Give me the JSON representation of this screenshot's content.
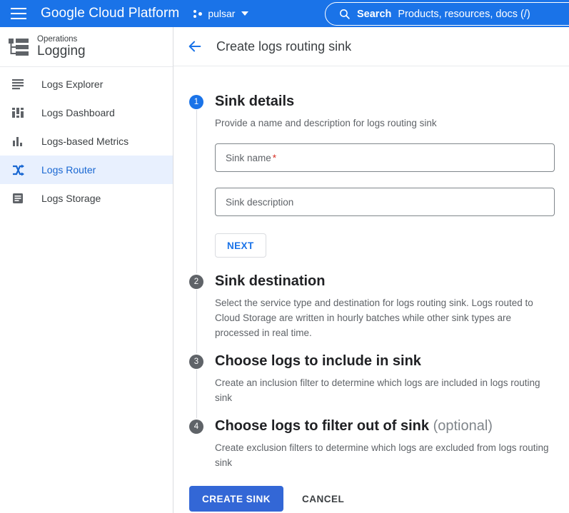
{
  "topbar": {
    "menu_icon": "hamburger-menu-icon",
    "brand": "Google Cloud Platform",
    "project_icon": "project-dots-icon",
    "project_name": "pulsar",
    "project_caret_icon": "chevron-down-icon",
    "search": {
      "icon": "search-icon",
      "label": "Search",
      "placeholder": "Products, resources, docs (/)"
    },
    "colors": {
      "background": "#1a73e8",
      "foreground": "#ffffff"
    }
  },
  "sidebar": {
    "product_icon": "logging-hierarchy-icon",
    "product_sub": "Operations",
    "product_title": "Logging",
    "items": [
      {
        "label": "Logs Explorer",
        "icon": "list-lines-icon",
        "active": false
      },
      {
        "label": "Logs Dashboard",
        "icon": "dashboard-icon",
        "active": false
      },
      {
        "label": "Logs-based Metrics",
        "icon": "bar-chart-icon",
        "active": false
      },
      {
        "label": "Logs Router",
        "icon": "shuffle-route-icon",
        "active": true
      },
      {
        "label": "Logs Storage",
        "icon": "storage-doc-icon",
        "active": false
      }
    ],
    "active_colors": {
      "background": "#e8f0fe",
      "text": "#1967d2"
    }
  },
  "page": {
    "back_icon": "back-arrow-icon",
    "title": "Create logs routing sink"
  },
  "steps": [
    {
      "number": "1",
      "title": "Sink details",
      "optional": "",
      "state": "active",
      "description": "Provide a name and description for logs routing sink",
      "fields": [
        {
          "placeholder": "Sink name",
          "required": true,
          "value": ""
        },
        {
          "placeholder": "Sink description",
          "required": false,
          "value": ""
        }
      ],
      "next_label": "NEXT"
    },
    {
      "number": "2",
      "title": "Sink destination",
      "optional": "",
      "state": "inactive",
      "description": "Select the service type and destination for logs routing sink. Logs routed to Cloud Storage are written in hourly batches while other sink types are processed in real time."
    },
    {
      "number": "3",
      "title": "Choose logs to include in sink",
      "optional": "",
      "state": "inactive",
      "description": "Create an inclusion filter to determine which logs are included in logs routing sink"
    },
    {
      "number": "4",
      "title": "Choose logs to filter out of sink",
      "optional": "(optional)",
      "state": "inactive",
      "description": "Create exclusion filters to determine which logs are excluded from logs routing sink"
    }
  ],
  "actions": {
    "primary_label": "CREATE SINK",
    "cancel_label": "CANCEL",
    "primary_color": "#3367d6"
  }
}
